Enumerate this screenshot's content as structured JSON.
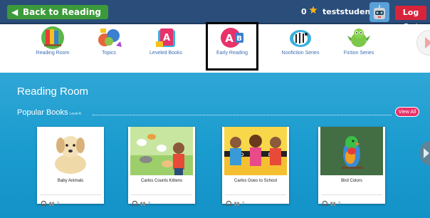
{
  "topbar": {
    "back_label": "Back to Reading",
    "stars_count": "0",
    "username": "teststudent",
    "logout_label": "Log Out"
  },
  "nav": {
    "items": [
      {
        "label": "Reading Room",
        "icon": "books-globe-icon"
      },
      {
        "label": "Topics",
        "icon": "topics-icon"
      },
      {
        "label": "Leveled Books",
        "icon": "leveled-books-icon"
      },
      {
        "label": "Early Reading",
        "icon": "abc-blocks-icon",
        "selected": true
      },
      {
        "label": "Nonfiction Series",
        "icon": "zebra-icon"
      },
      {
        "label": "Fiction Series",
        "icon": "dragon-icon"
      }
    ]
  },
  "main": {
    "section_title": "Reading Room",
    "popular_title": "Popular Books",
    "popular_level": "Level A",
    "view_all_label": "View All",
    "books": [
      {
        "title": "Baby Animals",
        "cover": "puppy"
      },
      {
        "title": "Carlos Counts Kittens",
        "cover": "kittens"
      },
      {
        "title": "Carlos Goes to School",
        "cover": "school"
      },
      {
        "title": "Bird Colors",
        "cover": "parrot"
      }
    ]
  },
  "colors": {
    "topbar": "#2a4d7a",
    "back_button": "#3c9a3a",
    "logout": "#d8243a",
    "main_bg": "#1b9ccf",
    "view_all": "#e8326a"
  }
}
